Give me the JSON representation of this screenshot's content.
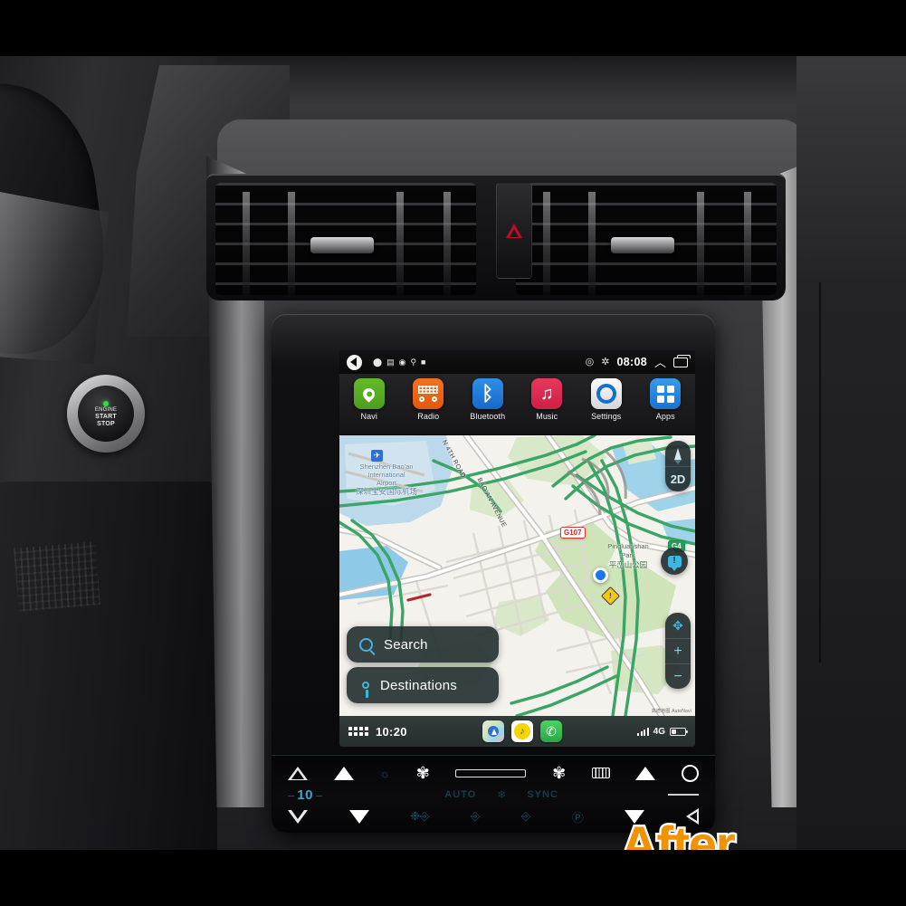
{
  "watermark": {
    "label": "After"
  },
  "car": {
    "engine_button": {
      "led": "on",
      "line1": "ENGINE",
      "line2": "START",
      "line3": "STOP"
    },
    "hazard_button": {
      "name": "hazard-lights"
    }
  },
  "head_unit": {
    "status_bar": {
      "back_icon": "back-icon",
      "left_icons": [
        "location-icon",
        "image-icon",
        "screenshot-icon",
        "usb-icon",
        "stop-icon"
      ],
      "wifi_icon": "wifi-icon",
      "bluetooth_icon": "bluetooth-icon",
      "time": "08:08",
      "chevron_icon": "chevron-up-icon",
      "recents_icon": "recent-apps-icon"
    },
    "apps": [
      {
        "label": "Navi",
        "icon": "navigation-pin-icon",
        "color": "#63bb2a"
      },
      {
        "label": "Radio",
        "icon": "radio-icon",
        "color": "#f2711f"
      },
      {
        "label": "Bluetooth",
        "icon": "bluetooth-icon",
        "color": "#2f8fe6"
      },
      {
        "label": "Music",
        "icon": "music-note-icon",
        "color": "#e8385c"
      },
      {
        "label": "Settings",
        "icon": "gear-icon",
        "color": "#fdfdfd"
      },
      {
        "label": "Apps",
        "icon": "app-grid-icon",
        "color": "#3b9ae8"
      }
    ],
    "map": {
      "airport_label_en_1": "Shenzhen Bao'an",
      "airport_label_en_2": "International",
      "airport_label_en_3": "Airport",
      "airport_label_zh": "深圳宝安国际机场",
      "road_1": "N 4TH ROAD",
      "road_2": "BAO'AN AVENUE",
      "highway_shield_1": "G107",
      "highway_shield_2": "G4",
      "park_label_en_1": "Pingluanshan",
      "park_label_en_2": "Park",
      "park_label_zh": "平峦山公园",
      "compass_icon": "compass-needle-icon",
      "view_mode": "2D",
      "pan_icon": "pan-arrows-icon",
      "zoom_in": "+",
      "zoom_out": "−",
      "alert_icon": "alert-bubble-icon",
      "attribution": "高德地图 AutoNavi",
      "cards": [
        {
          "label": "Search",
          "icon": "search-icon"
        },
        {
          "label": "Destinations",
          "icon": "map-pin-icon"
        }
      ]
    },
    "dock": {
      "apps_grid_icon": "app-grid-icon",
      "time": "10:20",
      "apps": [
        {
          "name": "maps-icon"
        },
        {
          "name": "qq-music-icon",
          "glyph": "♪"
        },
        {
          "name": "phone-icon",
          "glyph": "✆"
        }
      ],
      "signal_icon": "signal-bars-icon",
      "network": "4G",
      "battery_icon": "battery-icon"
    }
  },
  "hvac": {
    "temperature": "10",
    "dash_left": "–",
    "dash_right": "–",
    "auto_label": "AUTO",
    "sync_label": "SYNC",
    "snowflake_icon": "snowflake-icon",
    "fan_icon": "fan-icon",
    "front_defrost_icon": "front-defrost-icon",
    "rear_defrost_icon": "rear-defrost-icon",
    "seat_icon": "heated-seat-icon",
    "recirculate_icon": "air-recirculate-icon",
    "auto_recirc_icon": "auto-recirculation-icon",
    "power_icon": "power-circle-icon",
    "back_icon": "back-triangle-icon",
    "slider_icon": "fan-speed-slider"
  }
}
